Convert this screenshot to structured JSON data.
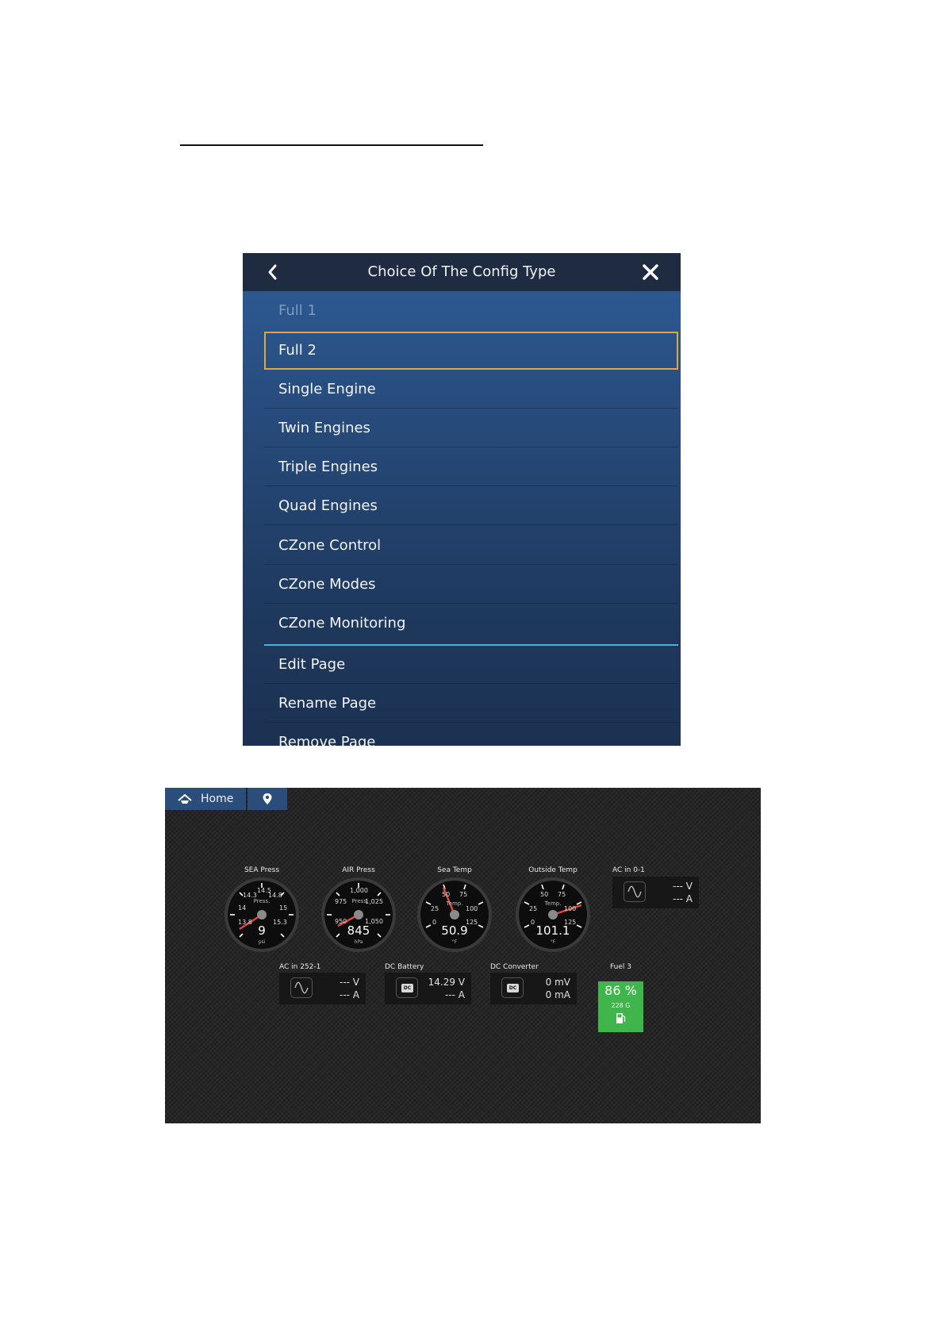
{
  "menu": {
    "title": "Choice Of The Config Type",
    "items": [
      {
        "label": "Full 1"
      },
      {
        "label": "Full 2"
      },
      {
        "label": "Single Engine"
      },
      {
        "label": "Twin Engines"
      },
      {
        "label": "Triple Engines"
      },
      {
        "label": "Quad Engines"
      },
      {
        "label": "CZone Control"
      },
      {
        "label": "CZone Modes"
      },
      {
        "label": "CZone Monitoring"
      }
    ],
    "actions": [
      {
        "label": "Edit Page"
      },
      {
        "label": "Rename Page"
      },
      {
        "label": "Remove Page"
      }
    ],
    "colors": {
      "header": "#1e2b41",
      "selection": "#e1a73a",
      "divider": "#3fb3e6"
    }
  },
  "dashboard": {
    "nav": {
      "home_label": "Home"
    },
    "gauges": [
      {
        "label": "SEA Press",
        "inner": "Press.",
        "unit": "psi",
        "value": "9",
        "ticks": [
          "14.5",
          "14.3",
          "14.8",
          "14",
          "15",
          "13.8",
          "15.3"
        ]
      },
      {
        "label": "AIR Press",
        "inner": "Press.",
        "unit": "hPa",
        "value": "845",
        "ticks": [
          "1,000",
          "975",
          "1,025",
          "950",
          "1,050"
        ]
      },
      {
        "label": "Sea Temp",
        "inner": "Temp.",
        "unit": "°F",
        "value": "50.9",
        "ticks": [
          "50",
          "75",
          "25",
          "100",
          "0",
          "125"
        ]
      },
      {
        "label": "Outside Temp",
        "inner": "Temp.",
        "unit": "°F",
        "value": "101.1",
        "ticks": [
          "50",
          "75",
          "25",
          "100",
          "0",
          "125"
        ]
      }
    ],
    "tiles": [
      {
        "label": "AC in 0-1",
        "line1": "--- V",
        "line2": "--- A",
        "icon": "sine-wave-icon"
      },
      {
        "label": "AC in 252-1",
        "line1": "--- V",
        "line2": "--- A",
        "icon": "sine-wave-icon"
      },
      {
        "label": "DC Battery",
        "badge": "DC",
        "line1": "14.29 V",
        "line2": "--- A",
        "icon": "battery-dc-icon"
      },
      {
        "label": "DC Converter",
        "badge": "DC",
        "line1": "0 mV",
        "line2": "0 mA",
        "icon": "converter-dc-icon"
      }
    ],
    "fuel": {
      "label": "Fuel 3",
      "percent": "86 %",
      "volume": "228 G",
      "color": "#3fb54b"
    }
  }
}
